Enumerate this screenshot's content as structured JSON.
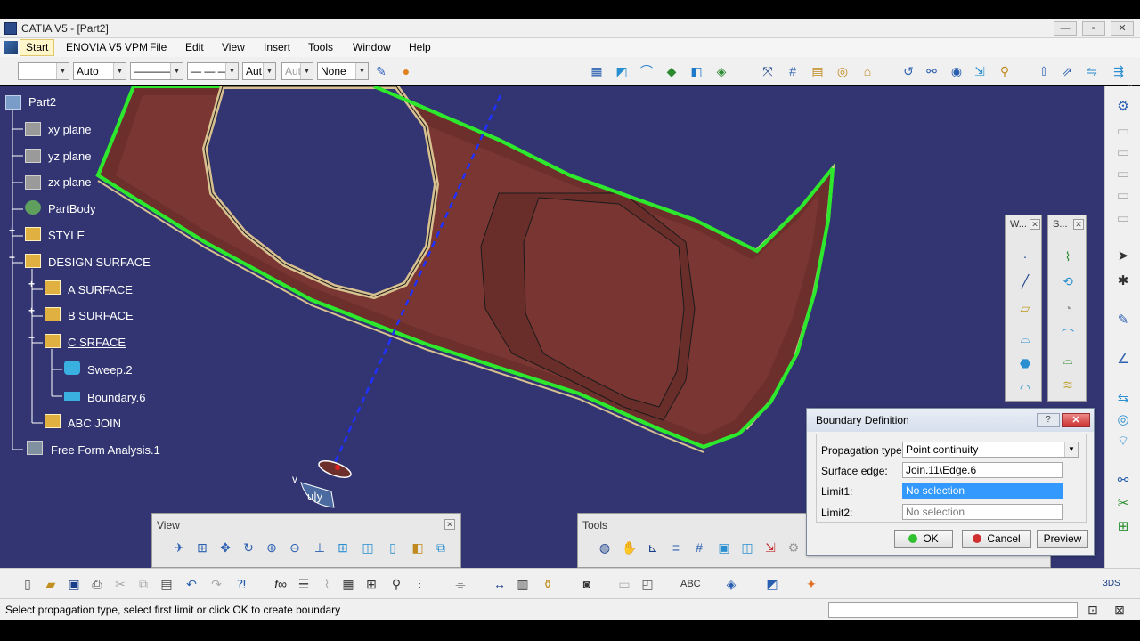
{
  "window": {
    "title": "CATIA V5 - [Part2]"
  },
  "menubar": {
    "items": [
      "Start",
      "ENOVIA V5 VPM",
      "File",
      "Edit",
      "View",
      "Insert",
      "Tools",
      "Window",
      "Help"
    ]
  },
  "toolbar": {
    "color_combo": "",
    "transparency_combo": "Auto",
    "linetype_combo": "————",
    "dash_combo": "— — —",
    "thickness_combo": "Aut",
    "point_combo": "Aut",
    "layer_combo": "None"
  },
  "tree": {
    "root": "Part2",
    "items": [
      {
        "label": "xy plane"
      },
      {
        "label": "yz plane"
      },
      {
        "label": "zx plane"
      },
      {
        "label": "PartBody"
      },
      {
        "label": "STYLE"
      },
      {
        "label": "DESIGN SURFACE"
      },
      {
        "label": "A SURFACE"
      },
      {
        "label": "B SURFACE"
      },
      {
        "label": "C SRFACE"
      },
      {
        "label": "Sweep.2"
      },
      {
        "label": "Boundary.6"
      },
      {
        "label": "ABC JOIN"
      },
      {
        "label": "Free Form Analysis.1"
      }
    ]
  },
  "panels": {
    "view": {
      "title": "View"
    },
    "tools": {
      "title": "Tools"
    },
    "wireframe": {
      "title": "W..."
    },
    "surfaces": {
      "title": "S..."
    }
  },
  "compass": {
    "label": "u|y",
    "v_label": "v"
  },
  "dialog": {
    "title": "Boundary Definition",
    "help": "?",
    "close": "✕",
    "propagation_label": "Propagation type:",
    "propagation_value": "Point continuity",
    "surface_edge_label": "Surface edge:",
    "surface_edge_value": "Join.11\\Edge.6",
    "limit1_label": "Limit1:",
    "limit1_value": "No selection",
    "limit2_label": "Limit2:",
    "limit2_value": "No selection",
    "ok": "OK",
    "cancel": "Cancel",
    "preview": "Preview"
  },
  "status": {
    "message": "Select propagation type, select first limit or click OK to create boundary"
  },
  "colors": {
    "background": "#323572",
    "surface": "#6b2f2a",
    "highlight": "#2ee82e"
  }
}
